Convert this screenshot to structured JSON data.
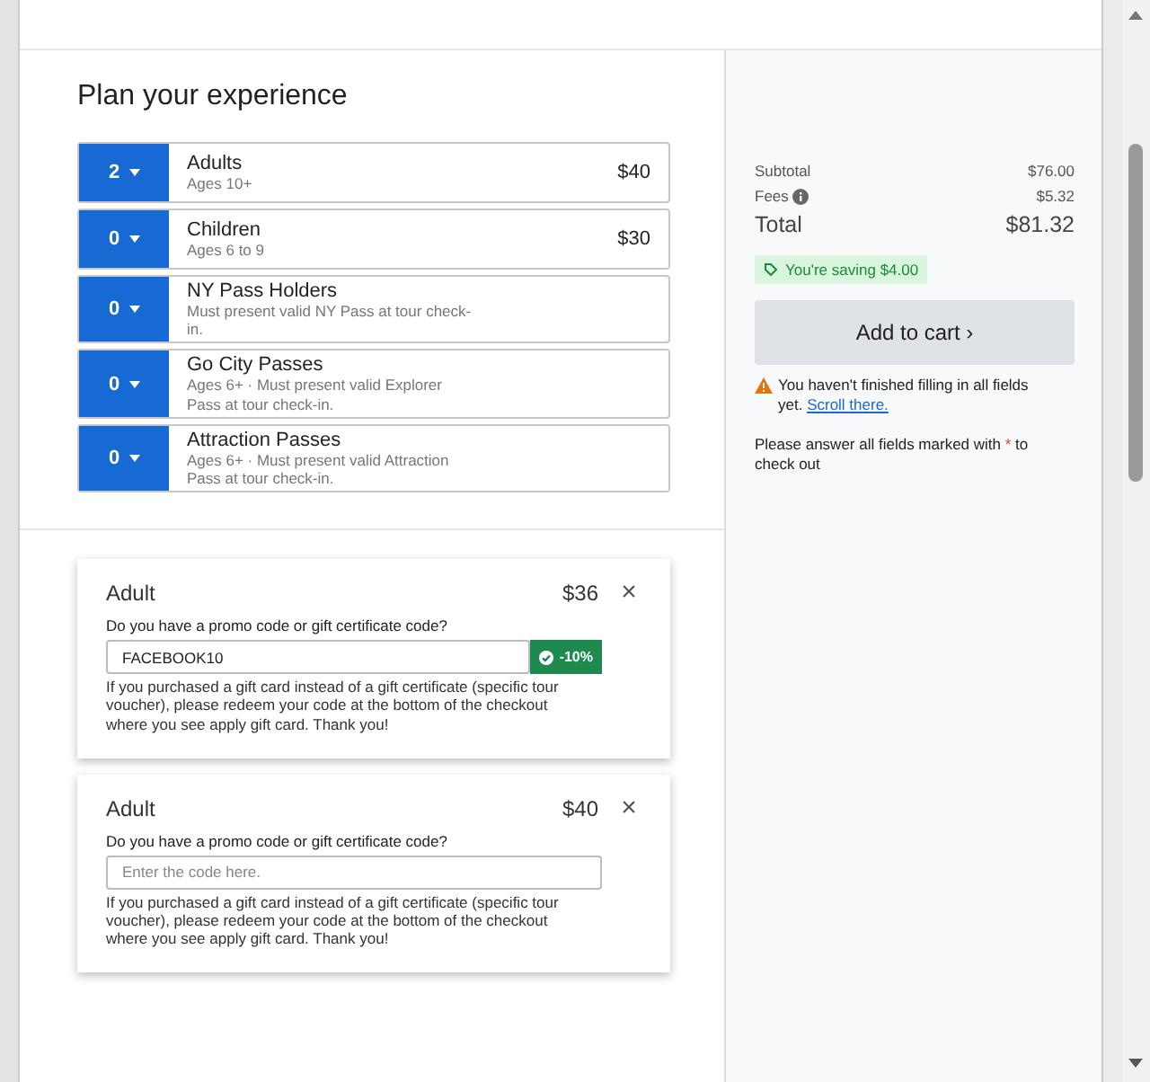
{
  "heading": "Plan your experience",
  "tickets": [
    {
      "count": "2",
      "name": "Adults",
      "note": "Ages 10+",
      "price": "$40"
    },
    {
      "count": "0",
      "name": "Children",
      "note": "Ages 6 to 9",
      "price": "$30"
    },
    {
      "count": "0",
      "name": "NY Pass Holders",
      "note": "Must present valid NY Pass at tour check-in."
    },
    {
      "count": "0",
      "name": "Go City Passes",
      "note": "Ages 6+ · Must present valid Explorer Pass at tour check-in."
    },
    {
      "count": "0",
      "name": "Attraction Passes",
      "note": "Ages 6+ · Must present valid Attraction Pass at tour check-in."
    }
  ],
  "promo_cards": [
    {
      "title": "Adult",
      "price": "$36",
      "close": "×",
      "question": "Do you have a promo code or gift certificate code?",
      "value": "FACEBOOK10",
      "badge": "-10%",
      "note": "If you purchased a gift card instead of a gift certificate (specific tour voucher), please redeem your code at the bottom of the checkout where you see apply gift card. Thank you!"
    },
    {
      "title": "Adult",
      "price": "$40",
      "close": "×",
      "question": "Do you have a promo code or gift certificate code?",
      "placeholder": "Enter the code here.",
      "note": "If you purchased a gift card instead of a gift certificate (specific tour voucher), please redeem your code at the bottom of the checkout where you see apply gift card. Thank you!"
    }
  ],
  "summary": {
    "rows": [
      {
        "kind": "plain",
        "label": "Subtotal",
        "value": "$76.00"
      },
      {
        "kind": "info",
        "label": "Fees",
        "value": "$5.32"
      },
      {
        "kind": "total",
        "label": "Total",
        "value": "$81.32"
      }
    ],
    "saving": "You're saving $4.00",
    "button": "Add to cart ›",
    "warning": "You haven't finished filling in all fields yet.",
    "warning_link": "Scroll there.",
    "required_note_before": "Please answer all fields marked with",
    "required_mark": "*",
    "required_note_after": "to check out"
  }
}
